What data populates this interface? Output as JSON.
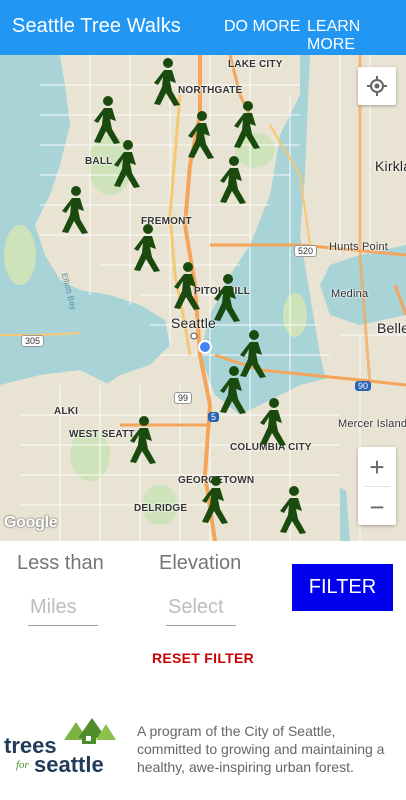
{
  "appbar": {
    "title": "Seattle Tree Walks",
    "do_more": "DO MORE",
    "learn_more": "LEARN MORE",
    "color": "#2196f3"
  },
  "map": {
    "labels": {
      "lake_city": "LAKE CITY",
      "northgate": "NORTHGATE",
      "ballard": "BALL",
      "fremont": "FREMONT",
      "capitol_hill": "PITOL HILL",
      "seattle": "Seattle",
      "alki": "ALKI",
      "west_seattle": "WEST SEATT",
      "columbia_city": "COLUMBIA CITY",
      "georgetown": "GEORGETOWN",
      "delridge": "DELRIDGE",
      "kirkland": "Kirkla",
      "hunts_point": "Hunts Point",
      "medina": "Medina",
      "bellevue": "Belle",
      "mercer_island": "Mercer Island",
      "elliott_bay": "Elliott Bay"
    },
    "road_badges": {
      "r520": "520",
      "r305": "305",
      "r99": "99",
      "r5": "5",
      "r90": "90"
    },
    "zoom_in": "+",
    "zoom_out": "−",
    "google": "Google",
    "walker_color": "#1b4a0f"
  },
  "filter": {
    "less_than_label": "Less than",
    "elevation_label": "Elevation",
    "miles_placeholder": "Miles",
    "select_placeholder": "Select",
    "filter_button": "FILTER",
    "reset_label": "RESET FILTER",
    "button_color": "#0000ee",
    "reset_color": "#cc0000"
  },
  "footer": {
    "logo_top": "trees",
    "logo_for": "for",
    "logo_bottom": "seattle",
    "description": "A program of the City of Seattle, committed to growing and maintaining a healthy, awe-inspiring urban forest."
  }
}
